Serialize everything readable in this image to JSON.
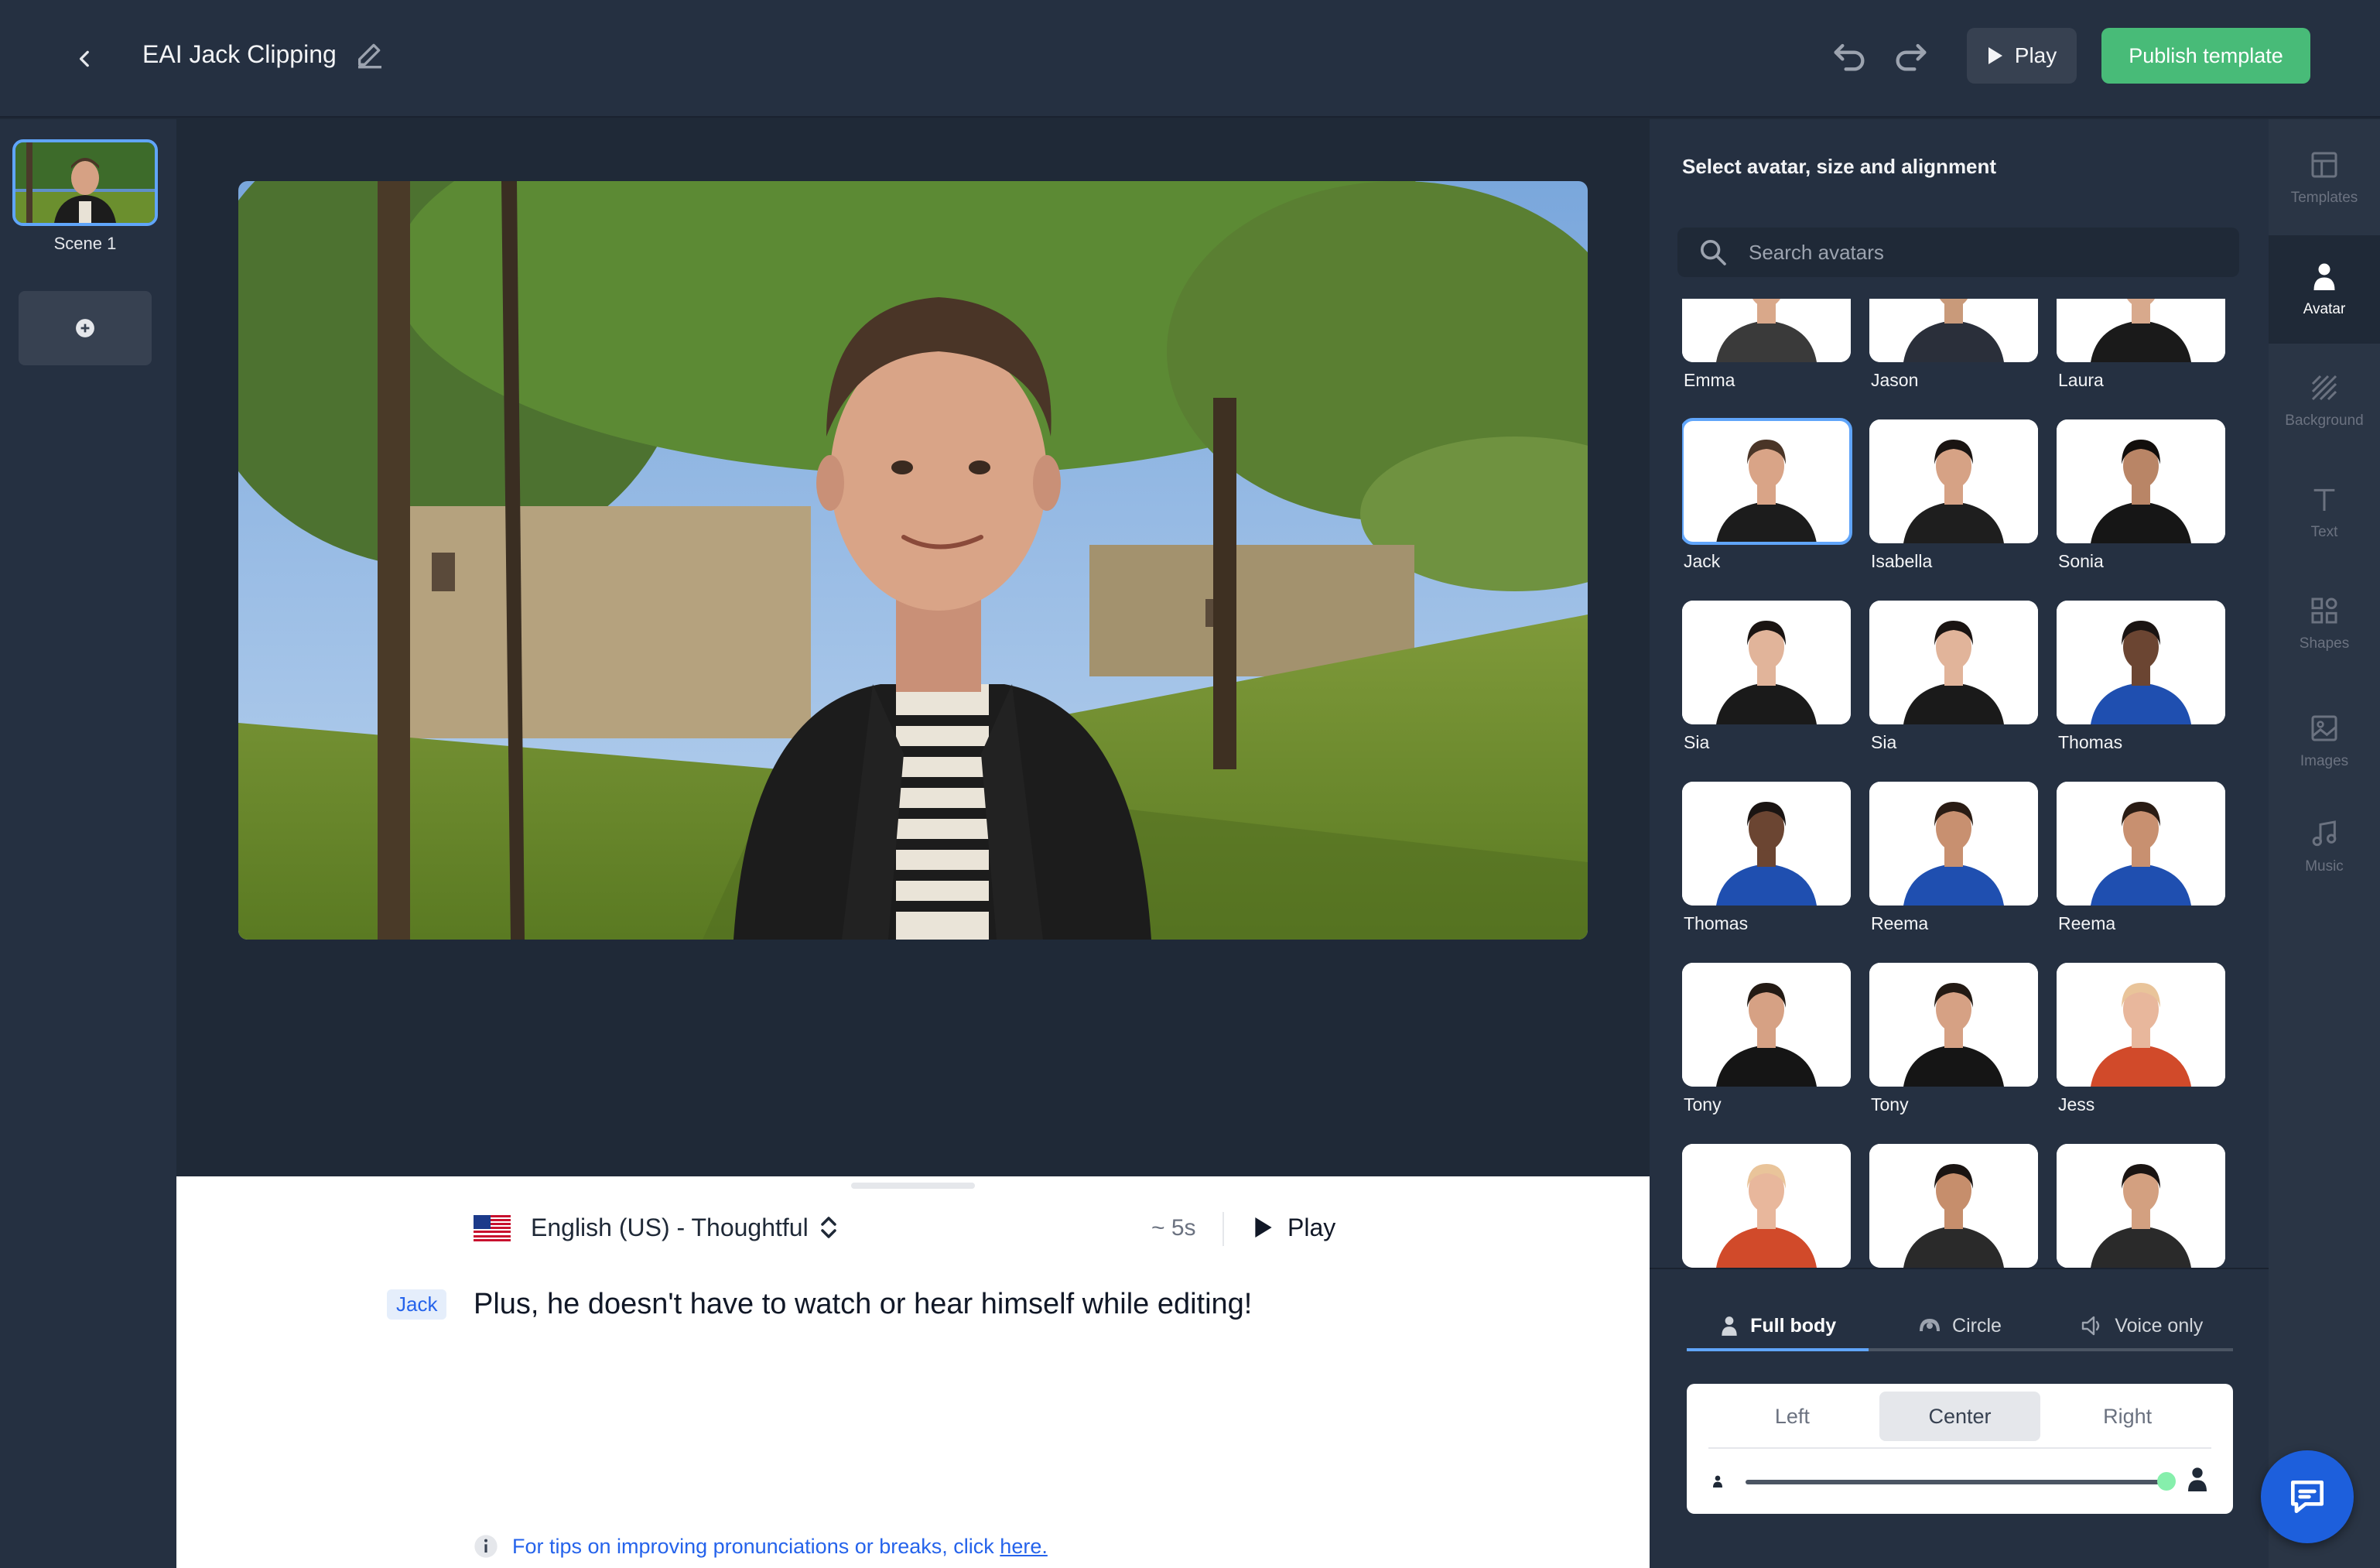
{
  "header": {
    "title": "EAI Jack Clipping",
    "play_label": "Play",
    "publish_label": "Publish template"
  },
  "scenes": {
    "items": [
      {
        "label": "Scene 1"
      }
    ]
  },
  "script": {
    "voice": "English (US) - Thoughtful",
    "duration": "~ 5s",
    "play_label": "Play",
    "speaker": "Jack",
    "text": "Plus, he doesn't have to watch or hear himself while editing!",
    "tips_prefix": "For tips on improving pronunciations or breaks, click",
    "tips_link": "here."
  },
  "panel": {
    "title": "Select avatar, size and alignment",
    "search_placeholder": "Search avatars",
    "avatars": [
      {
        "name": "Emma",
        "shirt": "#3a3a3a",
        "hair": "#3b2a20",
        "skin": "#d9a88a"
      },
      {
        "name": "Jason",
        "shirt": "#2a2f3a",
        "hair": "#2b2118",
        "skin": "#c99a7a"
      },
      {
        "name": "Laura",
        "shirt": "#1a1a1a",
        "hair": "#2a1f1a",
        "skin": "#d8a98c"
      },
      {
        "name": "Jack",
        "shirt": "#1c1c1c",
        "hair": "#4a3527",
        "skin": "#d9a487",
        "selected": true
      },
      {
        "name": "Isabella",
        "shirt": "#1e1e1e",
        "hair": "#1a1412",
        "skin": "#d6a285"
      },
      {
        "name": "Sonia",
        "shirt": "#161616",
        "hair": "#120e0c",
        "skin": "#b98566"
      },
      {
        "name": "Sia",
        "shirt": "#1a1a1a",
        "hair": "#1a1412",
        "skin": "#e1b49a"
      },
      {
        "name": "Sia",
        "shirt": "#1a1a1a",
        "hair": "#1a1412",
        "skin": "#e1b49a"
      },
      {
        "name": "Thomas",
        "shirt": "#1f4fb0",
        "hair": "#1a1412",
        "skin": "#6b4532"
      },
      {
        "name": "Thomas",
        "shirt": "#1f4fb0",
        "hair": "#1a1412",
        "skin": "#6b4532"
      },
      {
        "name": "Reema",
        "shirt": "#1f4fb0",
        "hair": "#2a1c14",
        "skin": "#c89070"
      },
      {
        "name": "Reema",
        "shirt": "#1f4fb0",
        "hair": "#2a1c14",
        "skin": "#c89070"
      },
      {
        "name": "Tony",
        "shirt": "#151515",
        "hair": "#231a14",
        "skin": "#d6a184"
      },
      {
        "name": "Tony",
        "shirt": "#151515",
        "hair": "#231a14",
        "skin": "#d6a184"
      },
      {
        "name": "Jess",
        "shirt": "#d14a2a",
        "hair": "#e9c49a",
        "skin": "#e8b79c"
      },
      {
        "name": "",
        "shirt": "#d14a2a",
        "hair": "#e9c49a",
        "skin": "#e8b79c"
      },
      {
        "name": "",
        "shirt": "#2a2a2a",
        "hair": "#1a1412",
        "skin": "#c68e6c"
      },
      {
        "name": "",
        "shirt": "#2a2a2a",
        "hair": "#1a1412",
        "skin": "#d3a080"
      }
    ],
    "size_tabs": [
      {
        "label": "Full body",
        "icon": "person-icon",
        "active": true
      },
      {
        "label": "Circle",
        "icon": "circle-avatar-icon"
      },
      {
        "label": "Voice only",
        "icon": "speaker-icon"
      }
    ],
    "alignment": {
      "options": [
        "Left",
        "Center",
        "Right"
      ],
      "selected": "Center"
    },
    "size_slider": {
      "value": 1.0
    }
  },
  "rail": {
    "items": [
      {
        "label": "Templates",
        "icon": "templates-icon"
      },
      {
        "label": "Avatar",
        "icon": "avatar-icon",
        "active": true
      },
      {
        "label": "Background",
        "icon": "background-icon"
      },
      {
        "label": "Text",
        "icon": "text-icon"
      },
      {
        "label": "Shapes",
        "icon": "shapes-icon"
      },
      {
        "label": "Images",
        "icon": "images-icon"
      },
      {
        "label": "Music",
        "icon": "music-icon"
      }
    ]
  }
}
